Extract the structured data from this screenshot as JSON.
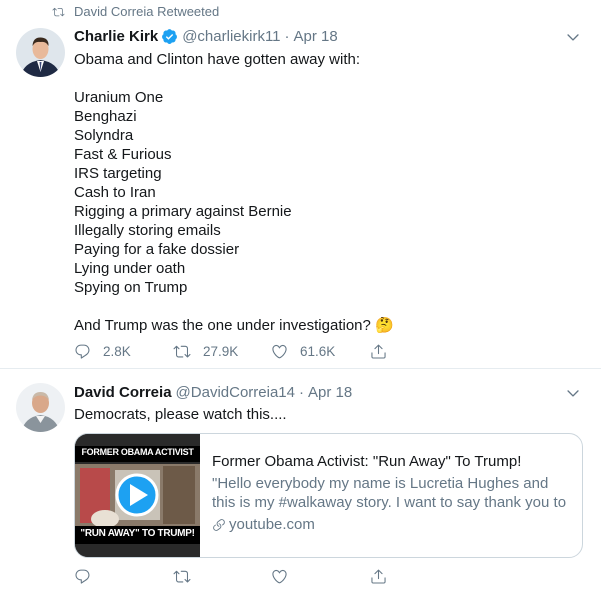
{
  "retweet_context": {
    "label": "David Correia Retweeted",
    "icon": "retweet-icon"
  },
  "tweet1": {
    "author_name": "Charlie Kirk",
    "verified": true,
    "handle": "@charliekirk11",
    "separator": "·",
    "date": "Apr 18",
    "lines": [
      "Obama and Clinton have gotten away with:",
      "",
      "Uranium One",
      "Benghazi",
      "Solyndra",
      "Fast & Furious",
      "IRS targeting",
      "Cash to Iran",
      "Rigging a primary against Bernie",
      "Illegally storing emails",
      "Paying for a fake dossier",
      "Lying under oath",
      "Spying on Trump",
      "",
      "And Trump was the one under investigation? 🤔"
    ],
    "actions": {
      "replies": "2.8K",
      "retweets": "27.9K",
      "likes": "61.6K"
    }
  },
  "tweet2": {
    "author_name": "David Correia",
    "handle": "@DavidCorreia14",
    "separator": "·",
    "date": "Apr 18",
    "text": "Democrats, please watch this....",
    "card": {
      "thumb_top_text": "FORMER OBAMA ACTIVIST",
      "thumb_bottom_text": "\"RUN AWAY\" TO TRUMP!",
      "title": "Former Obama Activist: \"Run Away\" To Trump!",
      "description": "\"Hello everybody my name is Lucretia Hughes and this is my #walkaway story. I want to say thank you to ...",
      "domain": "youtube.com"
    }
  },
  "colors": {
    "primary_text": "#14171a",
    "secondary_text": "#657786",
    "accent": "#1da1f2",
    "border": "#e6ecf0"
  }
}
